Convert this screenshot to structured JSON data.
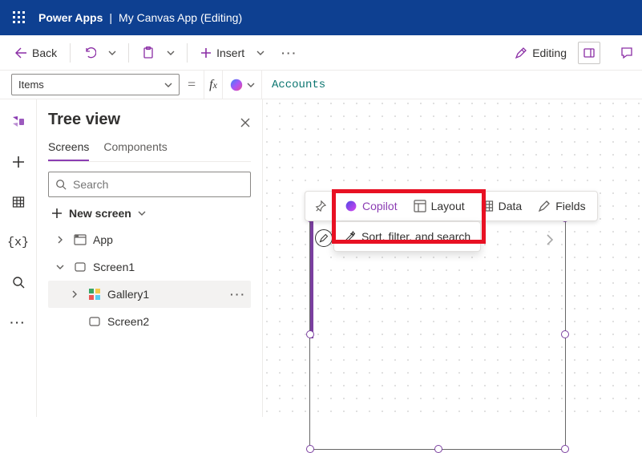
{
  "titlebar": {
    "app": "Power Apps",
    "sep": "|",
    "doc": "My Canvas App (Editing)"
  },
  "toolbar": {
    "back": "Back",
    "insert": "Insert",
    "editing": "Editing"
  },
  "formulabar": {
    "property": "Items",
    "value": "Accounts",
    "eq": "=",
    "fx": "fx"
  },
  "tree": {
    "title": "Tree view",
    "tabs": {
      "screens": "Screens",
      "components": "Components"
    },
    "search_placeholder": "Search",
    "newscreen": "New screen",
    "nodes": {
      "app": "App",
      "screen1": "Screen1",
      "gallery1": "Gallery1",
      "screen2": "Screen2"
    }
  },
  "floatbar": {
    "copilot": "Copilot",
    "layout": "Layout",
    "data": "Data",
    "fields": "Fields"
  },
  "drop": {
    "sfs": "Sort, filter, and search"
  },
  "leftrail": {
    "vars": "{x}"
  }
}
